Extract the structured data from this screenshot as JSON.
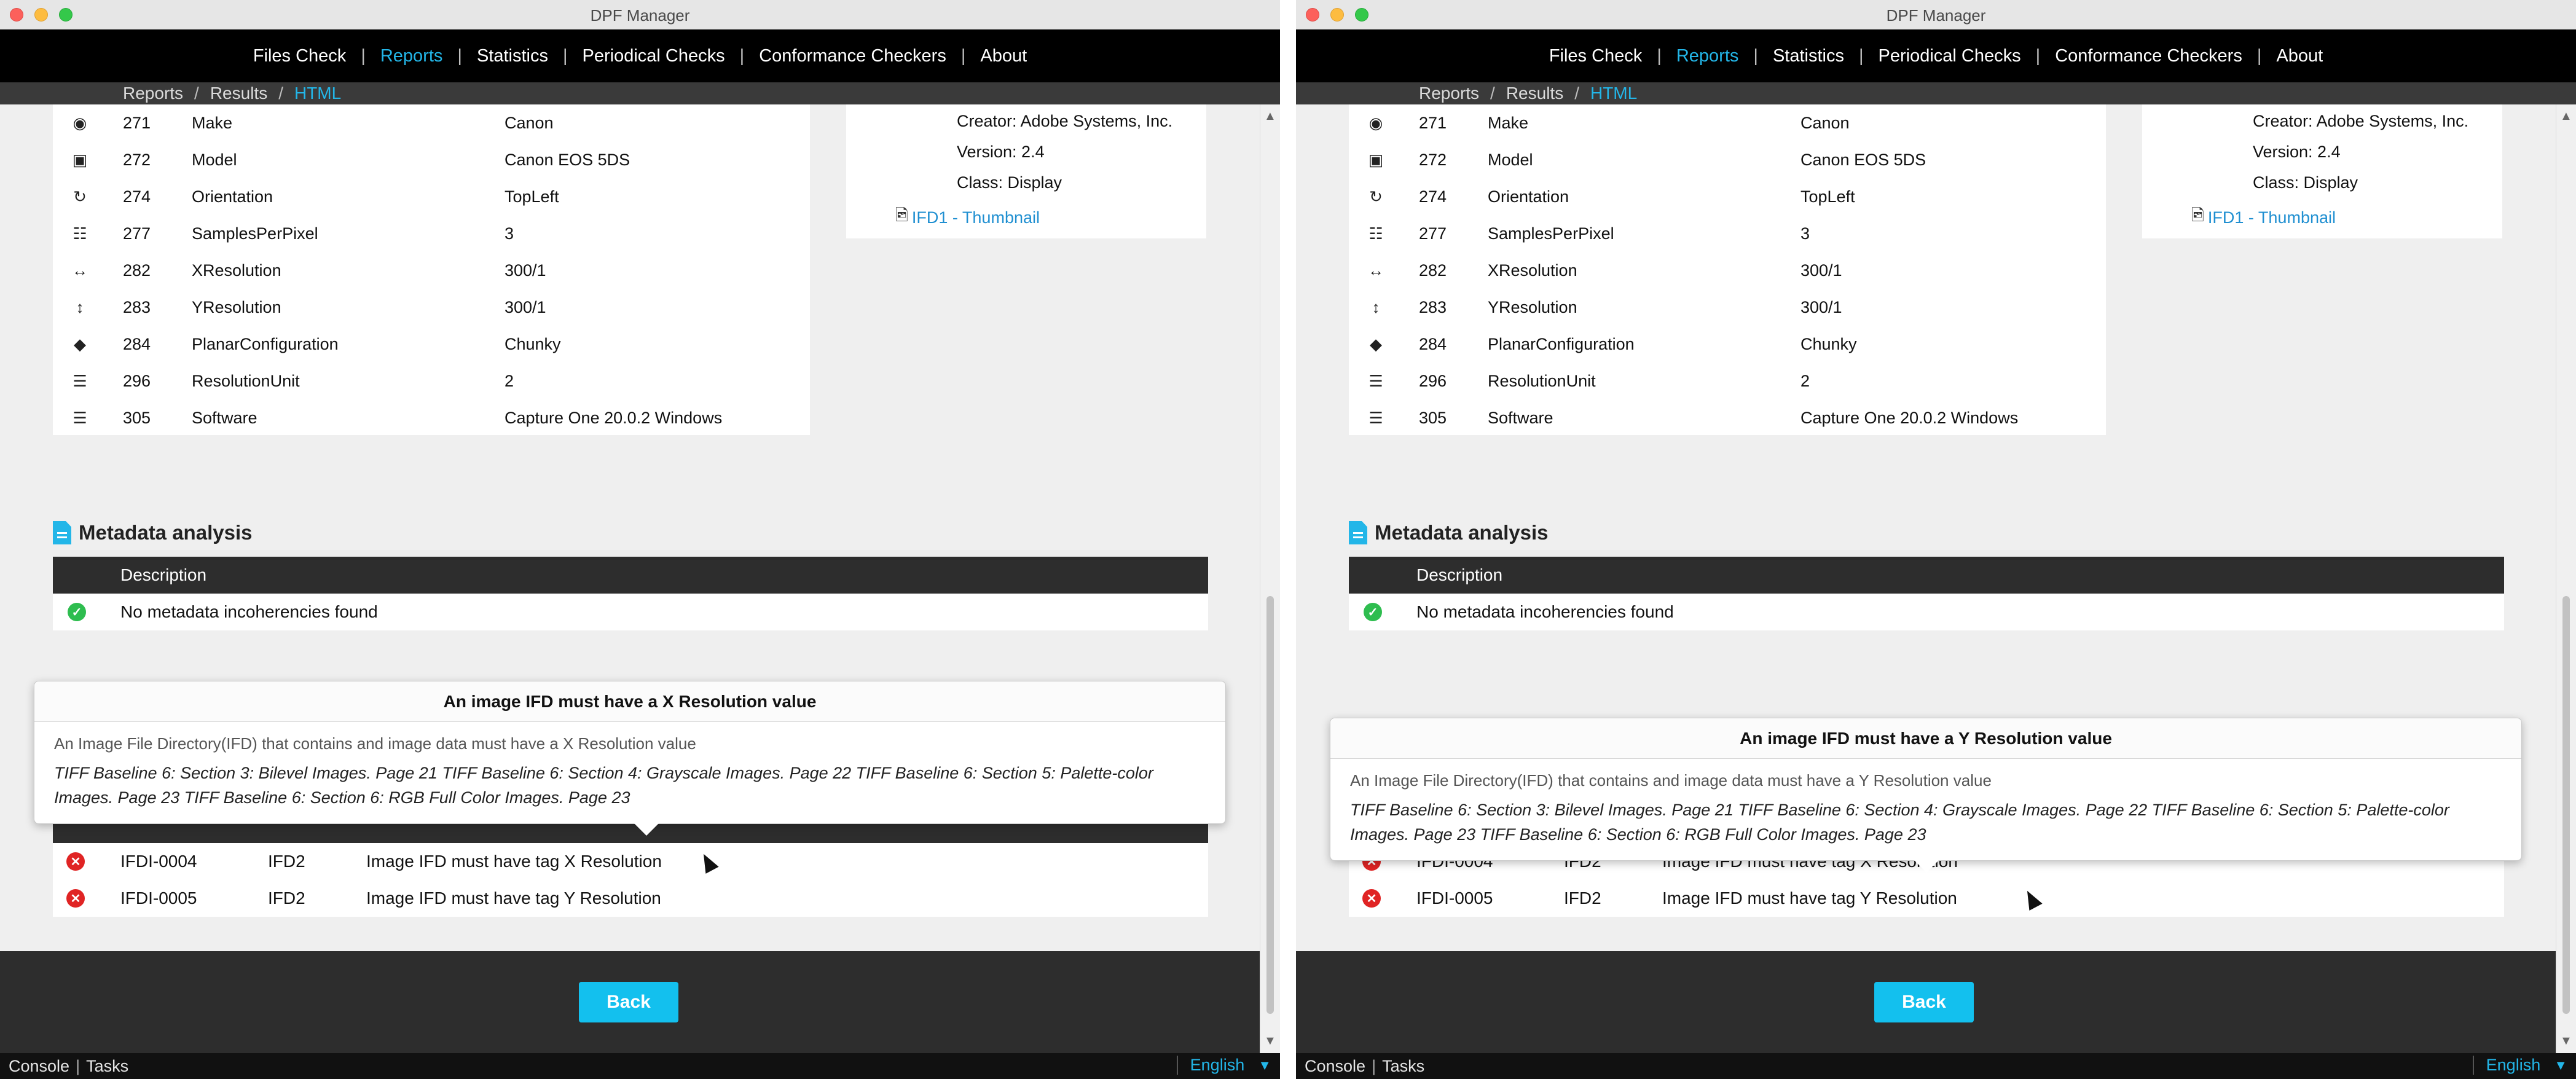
{
  "window": {
    "title": "DPF Manager"
  },
  "nav": {
    "items": [
      "Files Check",
      "Reports",
      "Statistics",
      "Periodical Checks",
      "Conformance Checkers",
      "About"
    ],
    "separator": "|"
  },
  "breadcrumb": {
    "items": [
      "Reports",
      "Results",
      "HTML"
    ],
    "separator": "/"
  },
  "tags": {
    "rows": [
      {
        "icon": "camera-icon",
        "id": "271",
        "name": "Make",
        "value": "Canon"
      },
      {
        "icon": "camera-card-icon",
        "id": "272",
        "name": "Model",
        "value": "Canon EOS 5DS"
      },
      {
        "icon": "rotate-icon",
        "id": "274",
        "name": "Orientation",
        "value": "TopLeft"
      },
      {
        "icon": "grid-icon",
        "id": "277",
        "name": "SamplesPerPixel",
        "value": "3"
      },
      {
        "icon": "horizontal-arrows-icon",
        "id": "282",
        "name": "XResolution",
        "value": "300/1"
      },
      {
        "icon": "vertical-arrows-icon",
        "id": "283",
        "name": "YResolution",
        "value": "300/1"
      },
      {
        "icon": "tag-icon",
        "id": "284",
        "name": "PlanarConfiguration",
        "value": "Chunky"
      },
      {
        "icon": "list-icon",
        "id": "296",
        "name": "ResolutionUnit",
        "value": "2"
      },
      {
        "icon": "list-icon",
        "id": "305",
        "name": "Software",
        "value": "Capture One 20.0.2 Windows"
      }
    ]
  },
  "ifd_panel": {
    "lines": [
      "Creator: Adobe Systems, Inc.",
      "Version: 2.4",
      "Class: Display"
    ],
    "link": "IFD1 - Thumbnail"
  },
  "metadata": {
    "title": "Metadata analysis",
    "header": "Description",
    "row": "No metadata incoherencies found"
  },
  "errors": {
    "rows": [
      {
        "id": "IFDI-0004",
        "location": "IFD2",
        "description": "Image IFD must have tag X Resolution"
      },
      {
        "id": "IFDI-0005",
        "location": "IFD2",
        "description": "Image IFD must have tag Y Resolution"
      }
    ]
  },
  "tooltip_left": {
    "title": "An image IFD must have a X Resolution value",
    "description": "An Image File Directory(IFD) that contains and image data must have a X Resolution value",
    "reference": "TIFF Baseline 6: Section 3: Bilevel Images. Page 21 TIFF Baseline 6: Section 4: Grayscale Images. Page 22 TIFF Baseline 6: Section 5: Palette-color Images. Page 23 TIFF Baseline 6: Section 6: RGB Full Color Images. Page 23"
  },
  "tooltip_right": {
    "title": "An image IFD must have a Y Resolution value",
    "description": "An Image File Directory(IFD) that contains and image data must have a Y Resolution value",
    "reference": "TIFF Baseline 6: Section 3: Bilevel Images. Page 21 TIFF Baseline 6: Section 4: Grayscale Images. Page 22 TIFF Baseline 6: Section 5: Palette-color Images. Page 23 TIFF Baseline 6: Section 6: RGB Full Color Images. Page 23"
  },
  "footer": {
    "back_label": "Back"
  },
  "statusbar": {
    "console": "Console",
    "tasks": "Tasks",
    "separator": "|",
    "language": "English"
  },
  "colors": {
    "accent": "#23b6e8",
    "button": "#13c0ee",
    "ok": "#2ebd4f",
    "error": "#e02424",
    "nav_bg": "#000000",
    "table_header": "#2d2d2d"
  }
}
